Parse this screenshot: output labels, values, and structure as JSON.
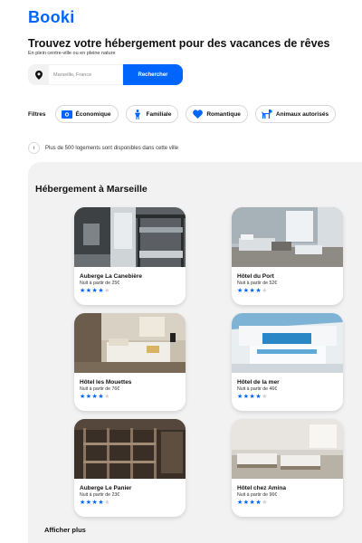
{
  "logo": "Booki",
  "hero": {
    "title": "Trouvez votre hébergement pour des vacances de rêves",
    "subtitle": "En plein centre-ville ou en pleine nature"
  },
  "search": {
    "placeholder": "Marseille, France",
    "button": "Rechercher"
  },
  "filters": {
    "label": "Filtres",
    "items": [
      {
        "label": "Économique",
        "icon": "money-icon"
      },
      {
        "label": "Familiale",
        "icon": "child-icon"
      },
      {
        "label": "Romantique",
        "icon": "heart-icon"
      },
      {
        "label": "Animaux autorisés",
        "icon": "dog-icon"
      }
    ]
  },
  "info": {
    "icon_text": "i",
    "text": "Plus de 500 logements sont disponibles dans cette ville"
  },
  "section": {
    "title": "Hébergement à Marseille",
    "more": "Afficher plus"
  },
  "accommodations": [
    {
      "name": "Auberge La Canebière",
      "price": "Nuit à partir de 25€",
      "rating": 4
    },
    {
      "name": "Hôtel du Port",
      "price": "Nuit à partir de 52€",
      "rating": 4
    },
    {
      "name": "Hôtel les Mouettes",
      "price": "Nuit à partir de 76€",
      "rating": 4
    },
    {
      "name": "Hôtel de la mer",
      "price": "Nuit à partir de 46€",
      "rating": 4
    },
    {
      "name": "Auberge Le Panier",
      "price": "Nuit à partir de 23€",
      "rating": 4
    },
    {
      "name": "Hôtel chez Amina",
      "price": "Nuit à partir de 96€",
      "rating": 4
    }
  ],
  "colors": {
    "accent": "#0065fc",
    "panel": "#f2f2f2"
  }
}
